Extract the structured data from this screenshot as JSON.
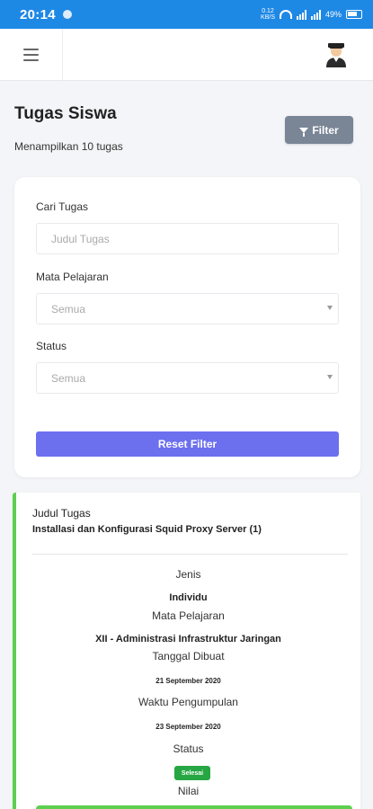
{
  "status_bar": {
    "time": "20:14",
    "net_speed_value": "0.12",
    "net_speed_unit": "KB/S",
    "battery": "49%",
    "color": "#1e88e5"
  },
  "nav": {
    "menu_icon": "hamburger-icon",
    "avatar_icon": "user-avatar-icon"
  },
  "page": {
    "title": "Tugas Siswa",
    "count_text": "Menampilkan 10 tugas",
    "filter_button_label": "Filter"
  },
  "filter": {
    "search_label": "Cari Tugas",
    "search_placeholder": "Judul Tugas",
    "subject_label": "Mata Pelajaran",
    "subject_selected": "Semua",
    "status_label": "Status",
    "status_selected": "Semua",
    "reset_button_label": "Reset Filter",
    "accent_color": "#6c6fee"
  },
  "task": {
    "title_label": "Judul Tugas",
    "title": "Installasi dan Konfigurasi Squid Proxy Server (1)",
    "type_label": "Jenis",
    "type": "Individu",
    "subject_label": "Mata Pelajaran",
    "subject": "XII - Administrasi Infrastruktur Jaringan",
    "created_label": "Tanggal Dibuat",
    "created": "21 September 2020",
    "deadline_label": "Waktu Pengumpulan",
    "deadline": "23 September 2020",
    "status_label": "Status",
    "status": "Selesai",
    "grade_label": "Nilai",
    "accent_color": "#5ccf4f",
    "status_color": "#27a744"
  }
}
